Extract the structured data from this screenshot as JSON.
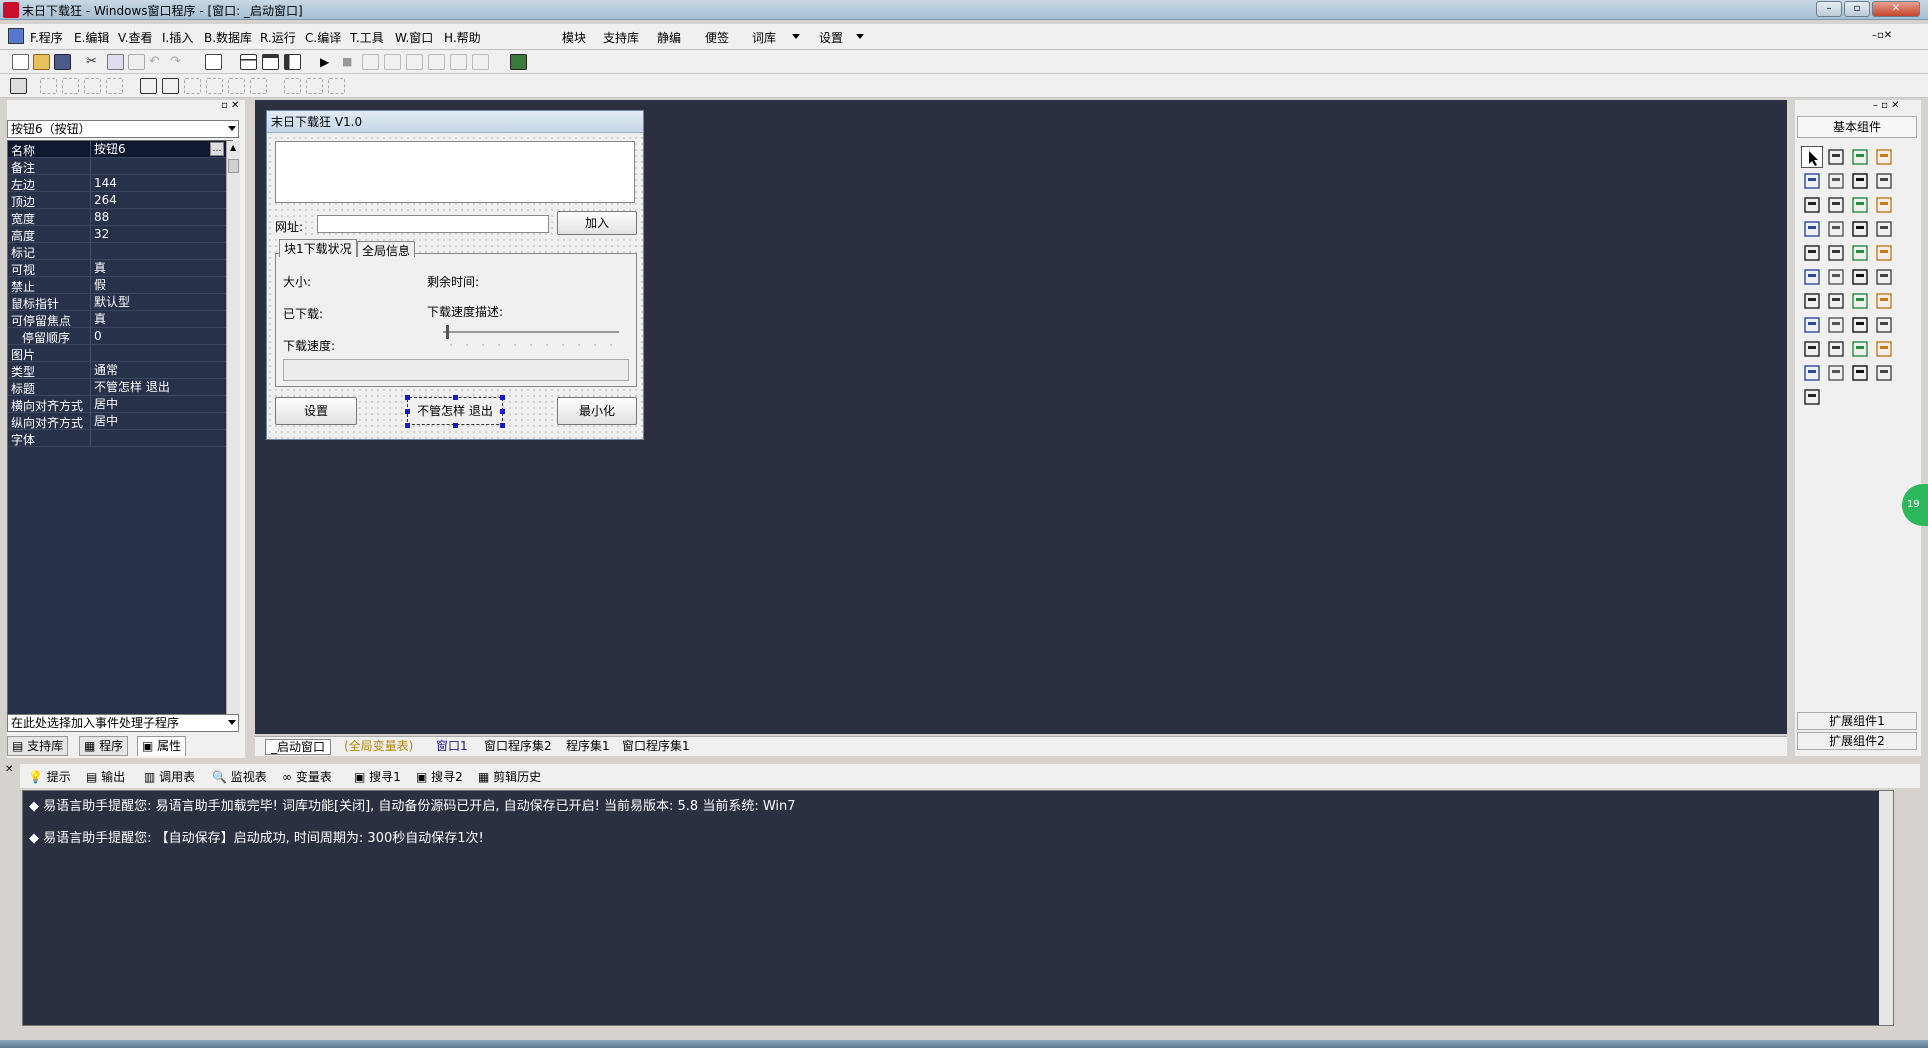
{
  "window": {
    "title": "末日下载狂 - Windows窗口程序 - [窗口: _启动窗口]",
    "min_label": "–",
    "max_label": "▫",
    "close_label": "✕"
  },
  "menu": {
    "items": [
      "F.程序",
      "E.编辑",
      "V.查看",
      "I.插入",
      "B.数据库",
      "R.运行",
      "C.编译",
      "T.工具",
      "W.窗口",
      "H.帮助"
    ],
    "extra": [
      "模块",
      "支持库",
      "静编",
      "便签",
      "词库",
      "设置"
    ]
  },
  "left_pane": {
    "object_combo": "按钮6（按钮）",
    "event_combo": "在此处选择加入事件处理子程序",
    "properties": [
      {
        "name": "名称",
        "value": "按钮6"
      },
      {
        "name": "备注",
        "value": ""
      },
      {
        "name": "左边",
        "value": "144"
      },
      {
        "name": "顶边",
        "value": "264"
      },
      {
        "name": "宽度",
        "value": "88"
      },
      {
        "name": "高度",
        "value": "32"
      },
      {
        "name": "标记",
        "value": ""
      },
      {
        "name": "可视",
        "value": "真"
      },
      {
        "name": "禁止",
        "value": "假"
      },
      {
        "name": "鼠标指针",
        "value": "默认型"
      },
      {
        "name": "可停留焦点",
        "value": "真"
      },
      {
        "name": "停留顺序",
        "value": "0"
      },
      {
        "name": "图片",
        "value": ""
      },
      {
        "name": "类型",
        "value": "通常"
      },
      {
        "name": "标题",
        "value": "不管怎样 退出"
      },
      {
        "name": "横向对齐方式",
        "value": "居中"
      },
      {
        "name": "纵向对齐方式",
        "value": "居中"
      },
      {
        "name": "字体",
        "value": ""
      }
    ],
    "tabs": [
      "支持库",
      "程序",
      "属性"
    ]
  },
  "form": {
    "title": "末日下载狂 V1.0",
    "url_label": "网址:",
    "add_button": "加入",
    "tabs": [
      "块1下载状况",
      "全局信息"
    ],
    "size_label": "大小:",
    "remaining_label": "剩余时间:",
    "downloaded_label": "已下载:",
    "speed_desc_label": "下载速度描述:",
    "speed_label": "下载速度:",
    "settings_button": "设置",
    "exit_button": "不管怎样 退出",
    "minimize_button": "最小化"
  },
  "right_pane": {
    "title": "基本组件",
    "ext1": "扩展组件1",
    "ext2": "扩展组件2"
  },
  "doc_tabs": [
    "_启动窗口",
    "(全局变量表)",
    "窗口1",
    "窗口程序集2",
    "程序集1",
    "窗口程序集1"
  ],
  "bottom_tabs": [
    "提示",
    "输出",
    "调用表",
    "监视表",
    "变量表",
    "搜寻1",
    "搜寻2",
    "剪辑历史"
  ],
  "output": [
    "易语言助手提醒您:  易语言助手加载完毕!  词库功能[关闭], 自动备份源码已开启, 自动保存已开启!  当前易版本: 5.8  当前系统: Win7",
    "易语言助手提醒您: 【自动保存】启动成功, 时间周期为: 300秒自动保存1次!"
  ],
  "side_badge": "19",
  "colors": {
    "dark_bg": "#2b3040",
    "prop_bg": "#28314a",
    "selection": "#101830"
  }
}
